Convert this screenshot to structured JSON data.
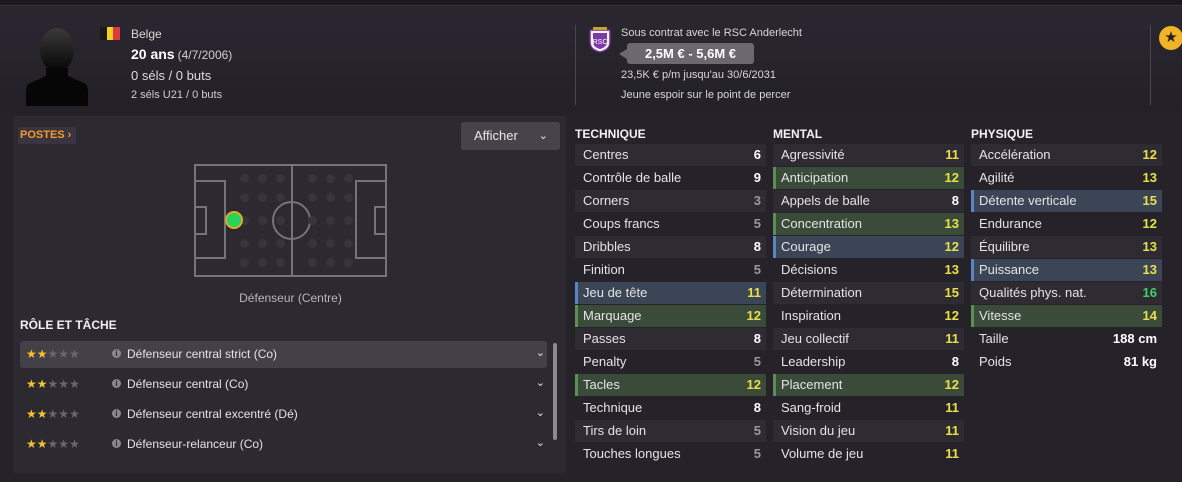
{
  "header": {
    "nationality": "Belge",
    "flag_colors": [
      "#1a1a1a",
      "#f3d21f",
      "#e03a3e"
    ],
    "age": "20 ans",
    "dob": "(4/7/2006)",
    "caps": "0 séls / 0 buts",
    "u21_caps": "2 séls U21 / 0 buts",
    "contract": "Sous contrat avec le RSC Anderlecht",
    "value": "2,5M € - 5,6M €",
    "wage": "23,5K € p/m jusqu'au 30/6/2031",
    "description": "Jeune espoir sur le point de percer",
    "badge_icon": "star-icon"
  },
  "positions": {
    "tab_label": "POSTES",
    "display_button": "Afficher",
    "position_name": "Défenseur (Centre)"
  },
  "roles": {
    "title": "RÔLE ET TÂCHE",
    "items": [
      {
        "name": "Défenseur central strict (Co)",
        "stars": 2,
        "max": 5
      },
      {
        "name": "Défenseur central (Co)",
        "stars": 2,
        "max": 5
      },
      {
        "name": "Défenseur central excentré (Dé)",
        "stars": 2,
        "max": 5
      },
      {
        "name": "Défenseur-relanceur (Co)",
        "stars": 2,
        "max": 5
      }
    ]
  },
  "value_colors": {
    "grey": "#9a979d",
    "white": "#ffffff",
    "yellow": "#e8e04a",
    "green": "#3fd06a"
  },
  "attributes": {
    "technique": {
      "title": "TECHNIQUE",
      "items": [
        {
          "name": "Centres",
          "value": "6",
          "tone": "white"
        },
        {
          "name": "Contrôle de balle",
          "value": "9",
          "tone": "white"
        },
        {
          "name": "Corners",
          "value": "3",
          "tone": "grey"
        },
        {
          "name": "Coups francs",
          "value": "5",
          "tone": "grey"
        },
        {
          "name": "Dribbles",
          "value": "8",
          "tone": "white"
        },
        {
          "name": "Finition",
          "value": "5",
          "tone": "grey"
        },
        {
          "name": "Jeu de tête",
          "value": "11",
          "tone": "yellow",
          "hl": "blue"
        },
        {
          "name": "Marquage",
          "value": "12",
          "tone": "yellow",
          "hl": "green"
        },
        {
          "name": "Passes",
          "value": "8",
          "tone": "white"
        },
        {
          "name": "Penalty",
          "value": "5",
          "tone": "grey"
        },
        {
          "name": "Tacles",
          "value": "12",
          "tone": "yellow",
          "hl": "green"
        },
        {
          "name": "Technique",
          "value": "8",
          "tone": "white"
        },
        {
          "name": "Tirs de loin",
          "value": "5",
          "tone": "grey"
        },
        {
          "name": "Touches longues",
          "value": "5",
          "tone": "grey"
        }
      ]
    },
    "mental": {
      "title": "MENTAL",
      "items": [
        {
          "name": "Agressivité",
          "value": "11",
          "tone": "yellow"
        },
        {
          "name": "Anticipation",
          "value": "12",
          "tone": "yellow",
          "hl": "green"
        },
        {
          "name": "Appels de balle",
          "value": "8",
          "tone": "white"
        },
        {
          "name": "Concentration",
          "value": "13",
          "tone": "yellow",
          "hl": "green"
        },
        {
          "name": "Courage",
          "value": "12",
          "tone": "yellow",
          "hl": "blue"
        },
        {
          "name": "Décisions",
          "value": "13",
          "tone": "yellow"
        },
        {
          "name": "Détermination",
          "value": "15",
          "tone": "yellow"
        },
        {
          "name": "Inspiration",
          "value": "12",
          "tone": "yellow"
        },
        {
          "name": "Jeu collectif",
          "value": "11",
          "tone": "yellow"
        },
        {
          "name": "Leadership",
          "value": "8",
          "tone": "white"
        },
        {
          "name": "Placement",
          "value": "12",
          "tone": "yellow",
          "hl": "green"
        },
        {
          "name": "Sang-froid",
          "value": "11",
          "tone": "yellow"
        },
        {
          "name": "Vision du jeu",
          "value": "11",
          "tone": "yellow"
        },
        {
          "name": "Volume de jeu",
          "value": "11",
          "tone": "yellow"
        }
      ]
    },
    "physique": {
      "title": "PHYSIQUE",
      "items": [
        {
          "name": "Accélération",
          "value": "12",
          "tone": "yellow"
        },
        {
          "name": "Agilité",
          "value": "13",
          "tone": "yellow"
        },
        {
          "name": "Détente verticale",
          "value": "15",
          "tone": "yellow",
          "hl": "blue"
        },
        {
          "name": "Endurance",
          "value": "12",
          "tone": "yellow"
        },
        {
          "name": "Équilibre",
          "value": "13",
          "tone": "yellow"
        },
        {
          "name": "Puissance",
          "value": "13",
          "tone": "yellow",
          "hl": "blue"
        },
        {
          "name": "Qualités phys. nat.",
          "value": "16",
          "tone": "green"
        },
        {
          "name": "Vitesse",
          "value": "14",
          "tone": "yellow",
          "hl": "green"
        },
        {
          "name": "Taille",
          "value": "188 cm",
          "tone": "white",
          "plain": true
        },
        {
          "name": "Poids",
          "value": "81 kg",
          "tone": "white",
          "plain": true
        }
      ]
    }
  }
}
